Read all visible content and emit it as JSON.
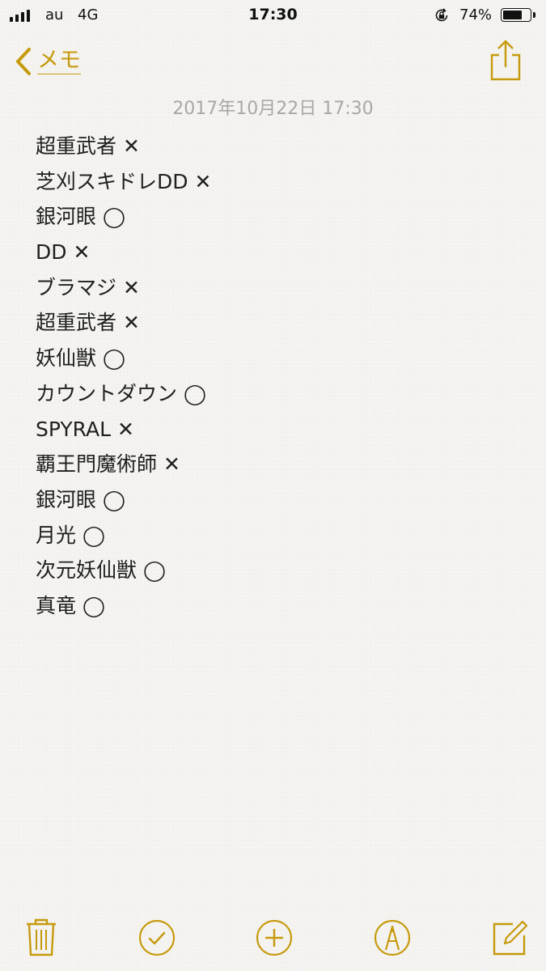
{
  "status_bar": {
    "carrier": "au",
    "network": "4G",
    "time": "17:30",
    "battery": "74%",
    "battery_level": 0.74,
    "icons": [
      "signal-icon",
      "rotation-lock-icon",
      "battery-icon"
    ]
  },
  "nav": {
    "back_label": "メモ",
    "back_icon": "chevron-left-icon",
    "share_icon": "share-icon",
    "accent_color": "#c69a0d"
  },
  "note": {
    "date": "2017年10月22日 17:30",
    "lines": [
      "超重武者 ✕",
      "芝刈スキドレDD ✕",
      "銀河眼 ◯",
      "DD ✕",
      "ブラマジ ✕",
      "超重武者 ✕",
      "妖仙獣 ◯",
      "カウントダウン ◯",
      "SPYRAL ✕",
      "覇王門魔術師 ✕",
      "銀河眼 ◯",
      "月光 ◯",
      "次元妖仙獣 ◯",
      "真竜 ◯"
    ]
  },
  "toolbar": {
    "icons": [
      "trash-icon",
      "checklist-icon",
      "add-icon",
      "markup-icon",
      "compose-icon"
    ]
  }
}
